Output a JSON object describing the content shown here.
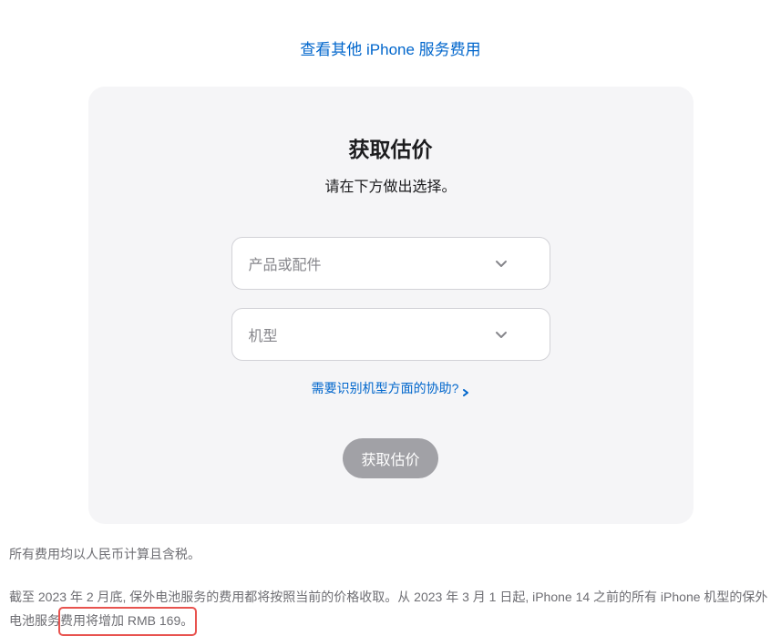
{
  "topLink": {
    "label": "查看其他 iPhone 服务费用"
  },
  "card": {
    "title": "获取估价",
    "subtitle": "请在下方做出选择。",
    "selects": {
      "product": {
        "placeholder": "产品或配件"
      },
      "model": {
        "placeholder": "机型"
      }
    },
    "helpLink": "需要识别机型方面的协助?",
    "submit": "获取估价"
  },
  "notes": {
    "first": "所有费用均以人民币计算且含税。",
    "second_a": "截至 2023 年 2 月底, 保外电池服务的费用都将按照当前的价格收取。从 2023 年 3 月 1 日起, iPhone 14 之前的所有 iPhone 机型的保外电池服务",
    "second_hl": "费用将增加 RMB 169。"
  }
}
